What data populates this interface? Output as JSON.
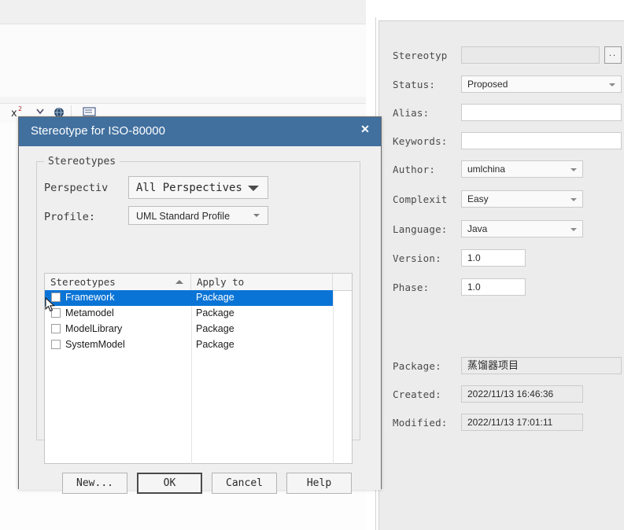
{
  "background": {
    "toolbar": {
      "items": [
        {
          "name": "x-superscript-icon",
          "glyph": "x²"
        },
        {
          "name": "chevron-down-icon",
          "glyph": "⌄"
        },
        {
          "name": "globe-icon",
          "glyph": "●"
        },
        {
          "name": "document-icon",
          "glyph": "☰"
        }
      ]
    }
  },
  "dialog": {
    "title": "Stereotype for ISO-80000",
    "close_label": "✕",
    "group_legend": "Stereotypes",
    "fields": [
      {
        "label": "Perspectiv",
        "value": "All Perspectives",
        "kind": "combo-mono"
      },
      {
        "label": "Profile:",
        "value": "UML Standard Profile",
        "kind": "combo-sans"
      }
    ],
    "table": {
      "columns": [
        "Stereotypes",
        "Apply to",
        ""
      ],
      "sort_column": "Stereotypes",
      "sort_direction": "ascending",
      "rows": [
        {
          "checked": false,
          "name": "Framework",
          "apply_to": "Package",
          "selected": true
        },
        {
          "checked": false,
          "name": "Metamodel",
          "apply_to": "Package",
          "selected": false
        },
        {
          "checked": false,
          "name": "ModelLibrary",
          "apply_to": "Package",
          "selected": false
        },
        {
          "checked": false,
          "name": "SystemModel",
          "apply_to": "Package",
          "selected": false
        }
      ]
    },
    "buttons": [
      {
        "label": "New...",
        "default": false
      },
      {
        "label": "OK",
        "default": true
      },
      {
        "label": "Cancel",
        "default": false
      },
      {
        "label": "Help",
        "default": false
      }
    ],
    "colors": {
      "titlebar": "#41709f",
      "selection": "#0a74d6",
      "body": "#efefef"
    }
  },
  "properties_panel": {
    "rows": [
      {
        "label": "Stereotyp",
        "value": "",
        "kind": "text-readonly",
        "has_dots_button": true,
        "dots_label": ".."
      },
      {
        "label": "Status:",
        "value": "Proposed",
        "kind": "combo-wide"
      },
      {
        "label": "Alias:",
        "value": "",
        "kind": "text"
      },
      {
        "label": "Keywords:",
        "value": "",
        "kind": "text"
      },
      {
        "label": "Author:",
        "value": "umlchina",
        "kind": "combo-narrow"
      },
      {
        "label": "Complexit",
        "value": "Easy",
        "kind": "combo-narrow"
      },
      {
        "label": "Language:",
        "value": "Java",
        "kind": "combo-narrow"
      },
      {
        "label": "Version:",
        "value": "1.0",
        "kind": "text-small"
      },
      {
        "label": "Phase:",
        "value": "1.0",
        "kind": "text-small"
      },
      {
        "label": "Package:",
        "value": "蒸馏器项目",
        "kind": "text-readonly-cjk"
      },
      {
        "label": "Created:",
        "value": "2022/11/13 16:46:36",
        "kind": "text-readonly-med"
      },
      {
        "label": "Modified:",
        "value": "2022/11/13 17:01:11",
        "kind": "text-readonly-med"
      }
    ]
  }
}
